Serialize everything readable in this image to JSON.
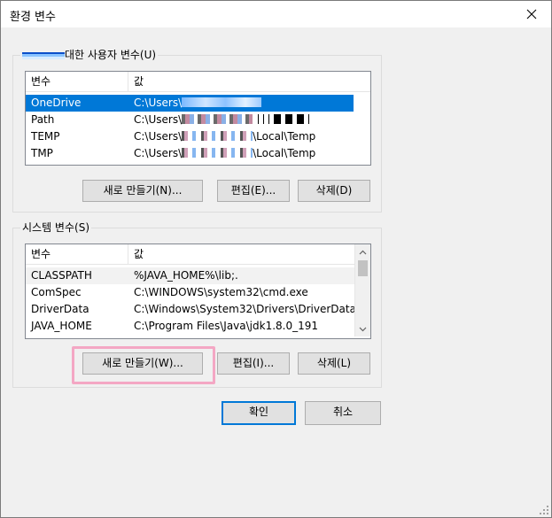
{
  "window": {
    "title": "환경 변수"
  },
  "user_vars": {
    "group_label": "대한 사용자 변수(U)",
    "columns": [
      "변수",
      "값"
    ],
    "rows": [
      {
        "name": "OneDrive",
        "value_prefix": "C:\\Users\\",
        "selected": true
      },
      {
        "name": "Path",
        "value_prefix": "C:\\Users\\",
        "selected": false
      },
      {
        "name": "TEMP",
        "value_prefix": "C:\\Users\\",
        "value_suffix": "\\Local\\Temp",
        "selected": false
      },
      {
        "name": "TMP",
        "value_prefix": "C:\\Users\\",
        "value_suffix": "\\Local\\Temp",
        "selected": false
      }
    ],
    "buttons": {
      "new": "새로 만들기(N)...",
      "edit": "편집(E)...",
      "delete": "삭제(D)"
    }
  },
  "system_vars": {
    "group_label": "시스템 변수(S)",
    "columns": [
      "변수",
      "값"
    ],
    "rows": [
      {
        "name": "CLASSPATH",
        "value": "%JAVA_HOME%\\lib;."
      },
      {
        "name": "ComSpec",
        "value": "C:\\WINDOWS\\system32\\cmd.exe"
      },
      {
        "name": "DriverData",
        "value": "C:\\Windows\\System32\\Drivers\\DriverData"
      },
      {
        "name": "JAVA_HOME",
        "value": "C:\\Program Files\\Java\\jdk1.8.0_191"
      }
    ],
    "buttons": {
      "new": "새로 만들기(W)...",
      "edit": "편집(I)...",
      "delete": "삭제(L)"
    }
  },
  "footer": {
    "ok": "확인",
    "cancel": "취소"
  },
  "colors": {
    "selection": "#0078d7",
    "highlight_border": "#f4a7c4",
    "default_button_border": "#0078d7"
  }
}
